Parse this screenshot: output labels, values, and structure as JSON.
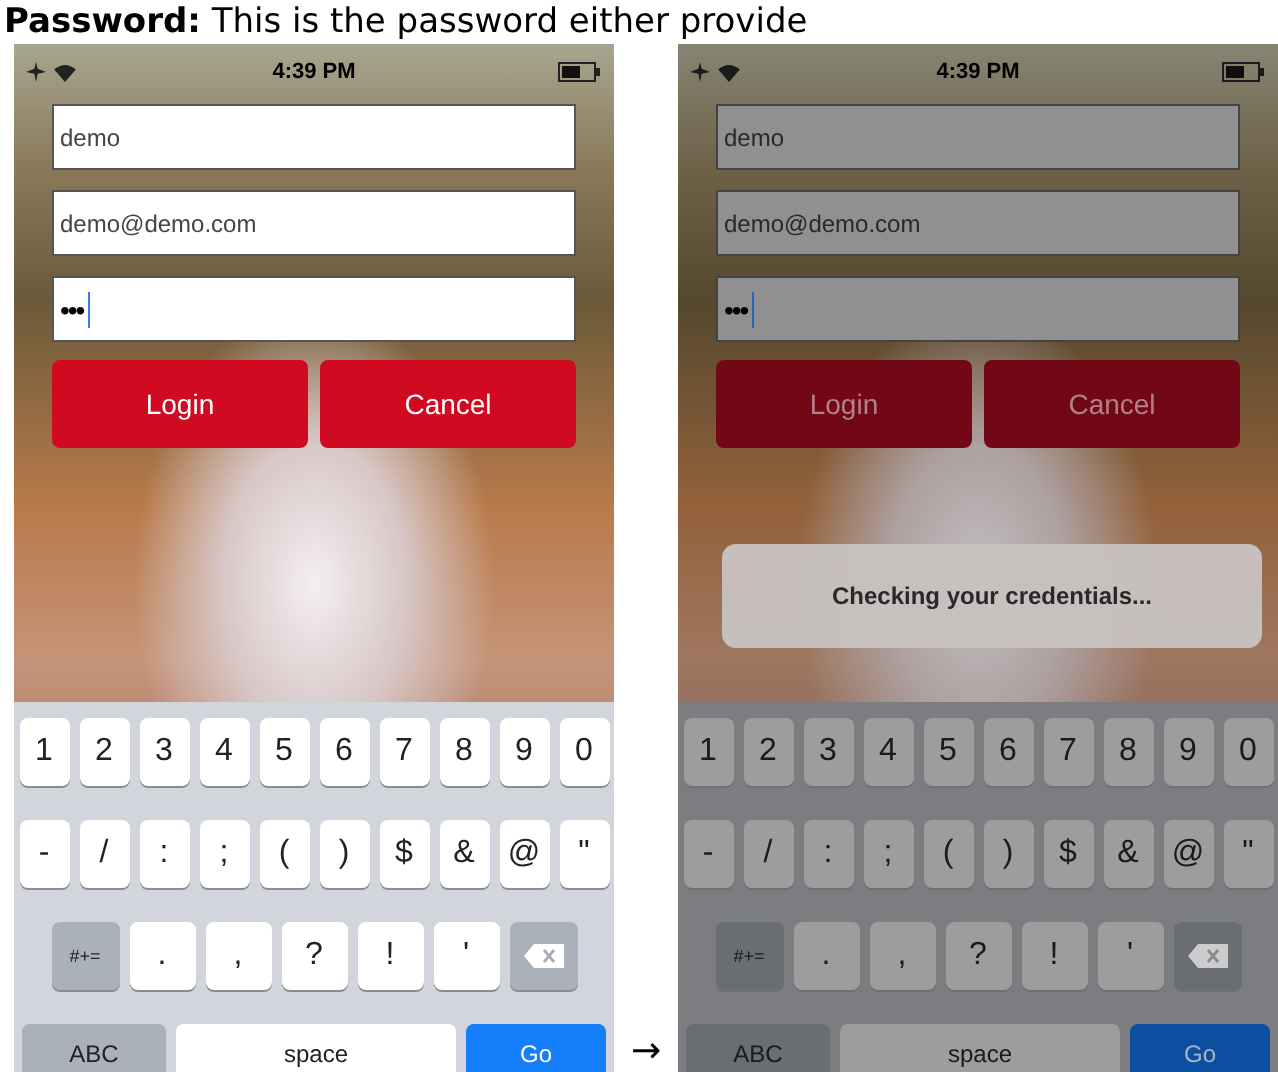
{
  "caption": "**Password:** This is the password either provide",
  "phones": [
    {
      "status_time": "4:39 PM",
      "dimmed": false,
      "fields": [
        {
          "value": "demo",
          "kind": "text"
        },
        {
          "value": "demo@demo.com",
          "kind": "text"
        },
        {
          "value": "•••",
          "kind": "password"
        }
      ],
      "buttons": [
        "Login",
        "Cancel"
      ],
      "keyboard": {
        "rows": [
          [
            "1",
            "2",
            "3",
            "4",
            "5",
            "6",
            "7",
            "8",
            "9",
            "0"
          ],
          [
            "-",
            "/",
            ":",
            ";",
            "(",
            ")",
            "$",
            "&",
            "@",
            "\""
          ]
        ],
        "symbols_key": "#+=",
        "punctuation": [
          ".",
          ",",
          "?",
          "!",
          "'"
        ],
        "abc_key": "ABC",
        "space_key": "space",
        "go_key": "Go"
      }
    },
    {
      "status_time": "4:39 PM",
      "dimmed": true,
      "alert": "Checking your credentials...",
      "fields": [
        {
          "value": "demo",
          "kind": "text"
        },
        {
          "value": "demo@demo.com",
          "kind": "text"
        },
        {
          "value": "•••",
          "kind": "password"
        }
      ],
      "buttons": [
        "Login",
        "Cancel"
      ],
      "keyboard": {
        "rows": [
          [
            "1",
            "2",
            "3",
            "4",
            "5",
            "6",
            "7",
            "8",
            "9",
            "0"
          ],
          [
            "-",
            "/",
            ":",
            ";",
            "(",
            ")",
            "$",
            "&",
            "@",
            "\""
          ]
        ],
        "symbols_key": "#+=",
        "punctuation": [
          ".",
          ",",
          "?",
          "!",
          "'"
        ],
        "abc_key": "ABC",
        "space_key": "space",
        "go_key": "Go"
      }
    }
  ],
  "arrow": "→"
}
